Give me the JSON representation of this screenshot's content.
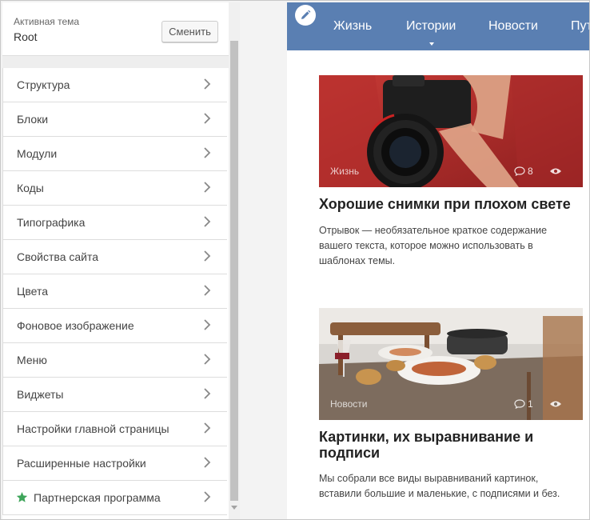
{
  "theme": {
    "caption": "Активная тема",
    "name": "Root",
    "change_label": "Сменить"
  },
  "menu": {
    "items": [
      {
        "label": "Структура"
      },
      {
        "label": "Блоки"
      },
      {
        "label": "Модули"
      },
      {
        "label": "Коды"
      },
      {
        "label": "Типографика"
      },
      {
        "label": "Свойства сайта"
      },
      {
        "label": "Цвета"
      },
      {
        "label": "Фоновое изображение"
      },
      {
        "label": "Меню"
      },
      {
        "label": "Виджеты"
      },
      {
        "label": "Настройки главной страницы"
      },
      {
        "label": "Расширенные настройки"
      },
      {
        "label": "Партнерская программа"
      }
    ]
  },
  "preview": {
    "nav": {
      "items": [
        "Жизнь",
        "Истории",
        "Новости",
        "Пут"
      ]
    },
    "posts": [
      {
        "category": "Жизнь",
        "comments": "8",
        "title": "Хорошие снимки при плохом свете",
        "excerpt": "Отрывок — необязательное краткое содержание вашего текста, которое можно использовать в шаблонах темы."
      },
      {
        "category": "Новости",
        "comments": "1",
        "title": "Картинки, их выравнивание и подписи",
        "excerpt": "Мы собрали все виды выравниваний картинок, вставили большие и маленькие, с подписями и без."
      }
    ]
  },
  "colors": {
    "nav_bg": "#5a7fb2",
    "star": "#3ea55a"
  }
}
